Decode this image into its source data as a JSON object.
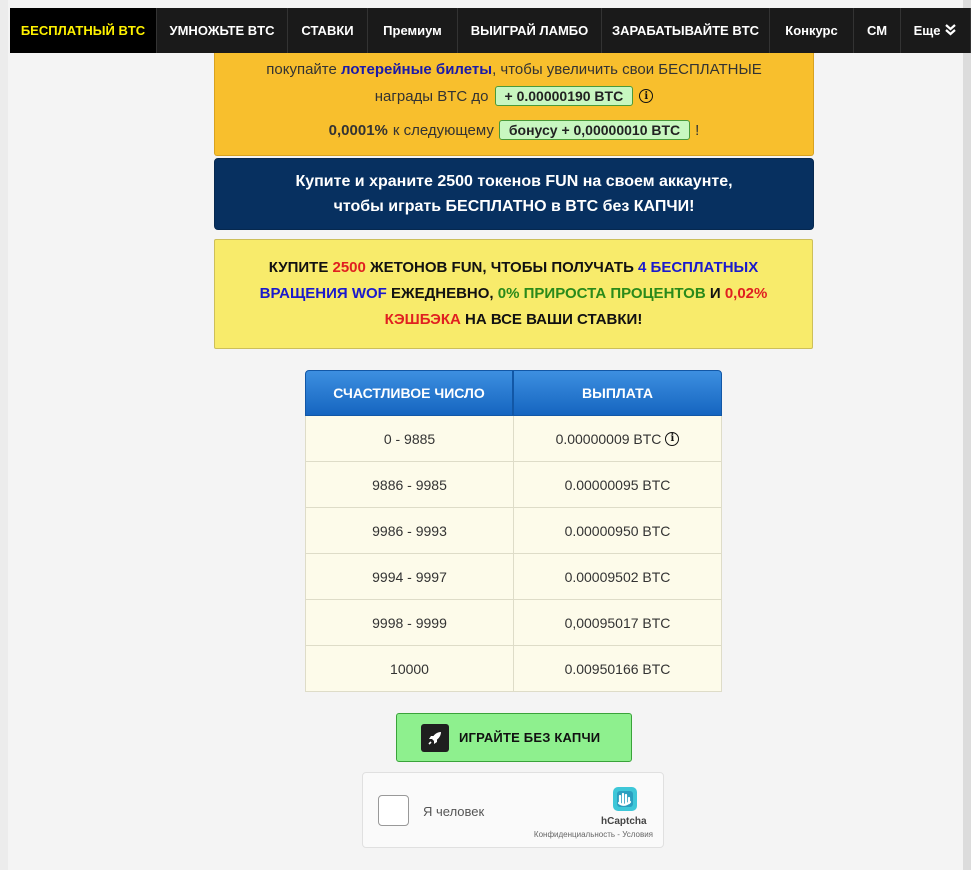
{
  "nav": {
    "items": [
      {
        "label": "БЕСПЛАТНЫЙ BTC",
        "active": true
      },
      {
        "label": "УМНОЖЬТЕ BTC"
      },
      {
        "label": "СТАВКИ"
      },
      {
        "label": "Премиум"
      },
      {
        "label": "ВЫИГРАЙ ЛАМБО"
      },
      {
        "label": "ЗАРАБАТЫВАЙТЕ BTC"
      },
      {
        "label": "Конкурс"
      },
      {
        "label": "СМ"
      },
      {
        "label": "Еще"
      }
    ],
    "more_icon": "double-chevron-down-icon",
    "active_color": "#fff200"
  },
  "lottery_box": {
    "line1_prefix": "покупайте ",
    "line1_link": "лотерейные билеты",
    "line1_suffix": ", чтобы увеличить свои БЕСПЛАТНЫЕ",
    "line2_prefix": "награды BTC до",
    "line2_pill": "+ 0.00000190 BTC",
    "line3_percent": "0,0001%",
    "line3_text": "к следующему",
    "line3_pill": "бонусу + 0,00000010 BTC",
    "line3_end": "!",
    "bg_color": "#f8bf2d"
  },
  "fun_box": {
    "text": "Купите и храните 2500 токенов FUN на своем аккаунте, чтобы играть БЕСПЛАТНО в BTC без КАПЧИ!",
    "bg_color": "#073060"
  },
  "wof_box": {
    "p1": "КУПИТЕ ",
    "p2": "2500",
    "p3": " ЖЕТОНОВ FUN, ЧТОБЫ ПОЛУЧАТЬ ",
    "p4": "4 БЕСПЛАТНЫХ ВРАЩЕНИЯ WOF",
    "p5": " ЕЖЕДНЕВНО, ",
    "p6": "0% ПРИРОСТА ПРОЦЕНТОВ",
    "p7": " И ",
    "p8": "0,02% КЭШБЭКА",
    "p9": " НА ВСЕ ВАШИ СТАВКИ!",
    "bg_color": "#f8eb6b"
  },
  "payout_table": {
    "headers": [
      "СЧАСТЛИВОЕ ЧИСЛО",
      "ВЫПЛАТА"
    ],
    "rows": [
      [
        "0 - 9885",
        "0.00000009 BTC"
      ],
      [
        "9886 - 9985",
        "0.00000095 BTC"
      ],
      [
        "9986 - 9993",
        "0.00000950 BTC"
      ],
      [
        "9994 - 9997",
        "0.00009502 BTC"
      ],
      [
        "9998 - 9999",
        "0,00095017 BTC"
      ],
      [
        "10000",
        "0.00950166 BTC"
      ]
    ],
    "header_color": "#1e74d0"
  },
  "play_button": {
    "label": "ИГРАЙТЕ БЕЗ КАПЧИ",
    "icon": "rocket-icon",
    "bg_color": "#8ef08e"
  },
  "captcha": {
    "label": "Я человек",
    "brand": "hCaptcha",
    "privacy": "Конфиденциальность",
    "separator": " - ",
    "terms": "Условия"
  }
}
